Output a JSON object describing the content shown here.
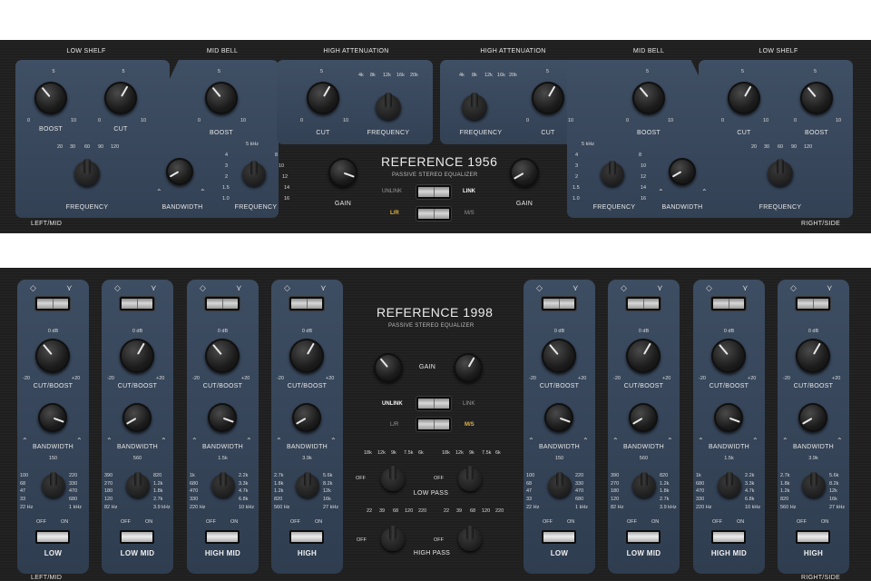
{
  "ref1956": {
    "title": "REFERENCE 1956",
    "subtitle": "PASSIVE STEREO EQUALIZER",
    "corner_left": "LEFT/MID",
    "corner_right": "RIGHT/SIDE",
    "sections": {
      "low_shelf": "LOW SHELF",
      "mid_bell": "MID BELL",
      "high_atten": "HIGH ATTENUATION"
    },
    "labels": {
      "boost": "BOOST",
      "cut": "CUT",
      "frequency": "FREQUENCY",
      "bandwidth": "BANDWIDTH",
      "gain": "GAIN"
    },
    "scale": {
      "min": "0",
      "mid": "5",
      "max": "10"
    },
    "low_freqs": [
      "20",
      "30",
      "60",
      "90",
      "120"
    ],
    "mid_freqs_left": [
      "4",
      "3",
      "2",
      "1.5",
      "1.0"
    ],
    "mid_freqs_right": [
      "8",
      "10",
      "12",
      "14",
      "16"
    ],
    "mid_freq_top": "5 kHz",
    "high_freqs": [
      "4k",
      "8k",
      "12k",
      "16k",
      "20k"
    ],
    "switches": {
      "unlink": "UNLINK",
      "link": "LINK",
      "lr": "L/R",
      "ms": "M/S"
    }
  },
  "ref1998": {
    "title": "REFERENCE 1998",
    "subtitle": "PASSIVE STEREO EQUALIZER",
    "corner_left": "LEFT/MID",
    "corner_right": "RIGHT/SIDE",
    "labels": {
      "cut_boost": "CUT/BOOST",
      "bandwidth": "BANDWIDTH",
      "gain": "GAIN",
      "low_pass": "LOW PASS",
      "high_pass": "HIGH PASS",
      "off_on_off": "OFF",
      "off_on_on": "ON",
      "off": "OFF"
    },
    "db_top": "0 dB",
    "db_min": "-20",
    "db_max": "+20",
    "switches": {
      "unlink": "UNLINK",
      "link": "LINK",
      "lr": "L/R",
      "ms": "M/S"
    },
    "bands": [
      {
        "name": "LOW",
        "top": "150",
        "left": [
          "100",
          "68",
          "47",
          "33",
          "22 Hz"
        ],
        "right": [
          "220",
          "330",
          "470",
          "680",
          "1 kHz"
        ]
      },
      {
        "name": "LOW MID",
        "top": "560",
        "left": [
          "390",
          "270",
          "180",
          "120",
          "82 Hz"
        ],
        "right": [
          "820",
          "1.2k",
          "1.8k",
          "2.7k",
          "3.9 kHz"
        ]
      },
      {
        "name": "HIGH MID",
        "top": "1.5k",
        "left": [
          "1k",
          "680",
          "470",
          "330",
          "220 Hz"
        ],
        "right": [
          "2.2k",
          "3.3k",
          "4.7k",
          "6.8k",
          "10 kHz"
        ]
      },
      {
        "name": "HIGH",
        "top": "3.9k",
        "left": [
          "2.7k",
          "1.8k",
          "1.2k",
          "820",
          "560 Hz"
        ],
        "right": [
          "5.6k",
          "8.2k",
          "12k",
          "16k",
          "27 kHz"
        ]
      }
    ],
    "lp_freqs": [
      "18k",
      "12k",
      "9k",
      "7.5k",
      "6k"
    ],
    "hp_freqs": [
      "22",
      "39",
      "68",
      "120",
      "220"
    ]
  },
  "icons": {
    "shelf": "shelf-icon",
    "bell": "bell-icon",
    "bw_narrow": "bandwidth-narrow-icon",
    "bw_wide": "bandwidth-wide-icon"
  }
}
